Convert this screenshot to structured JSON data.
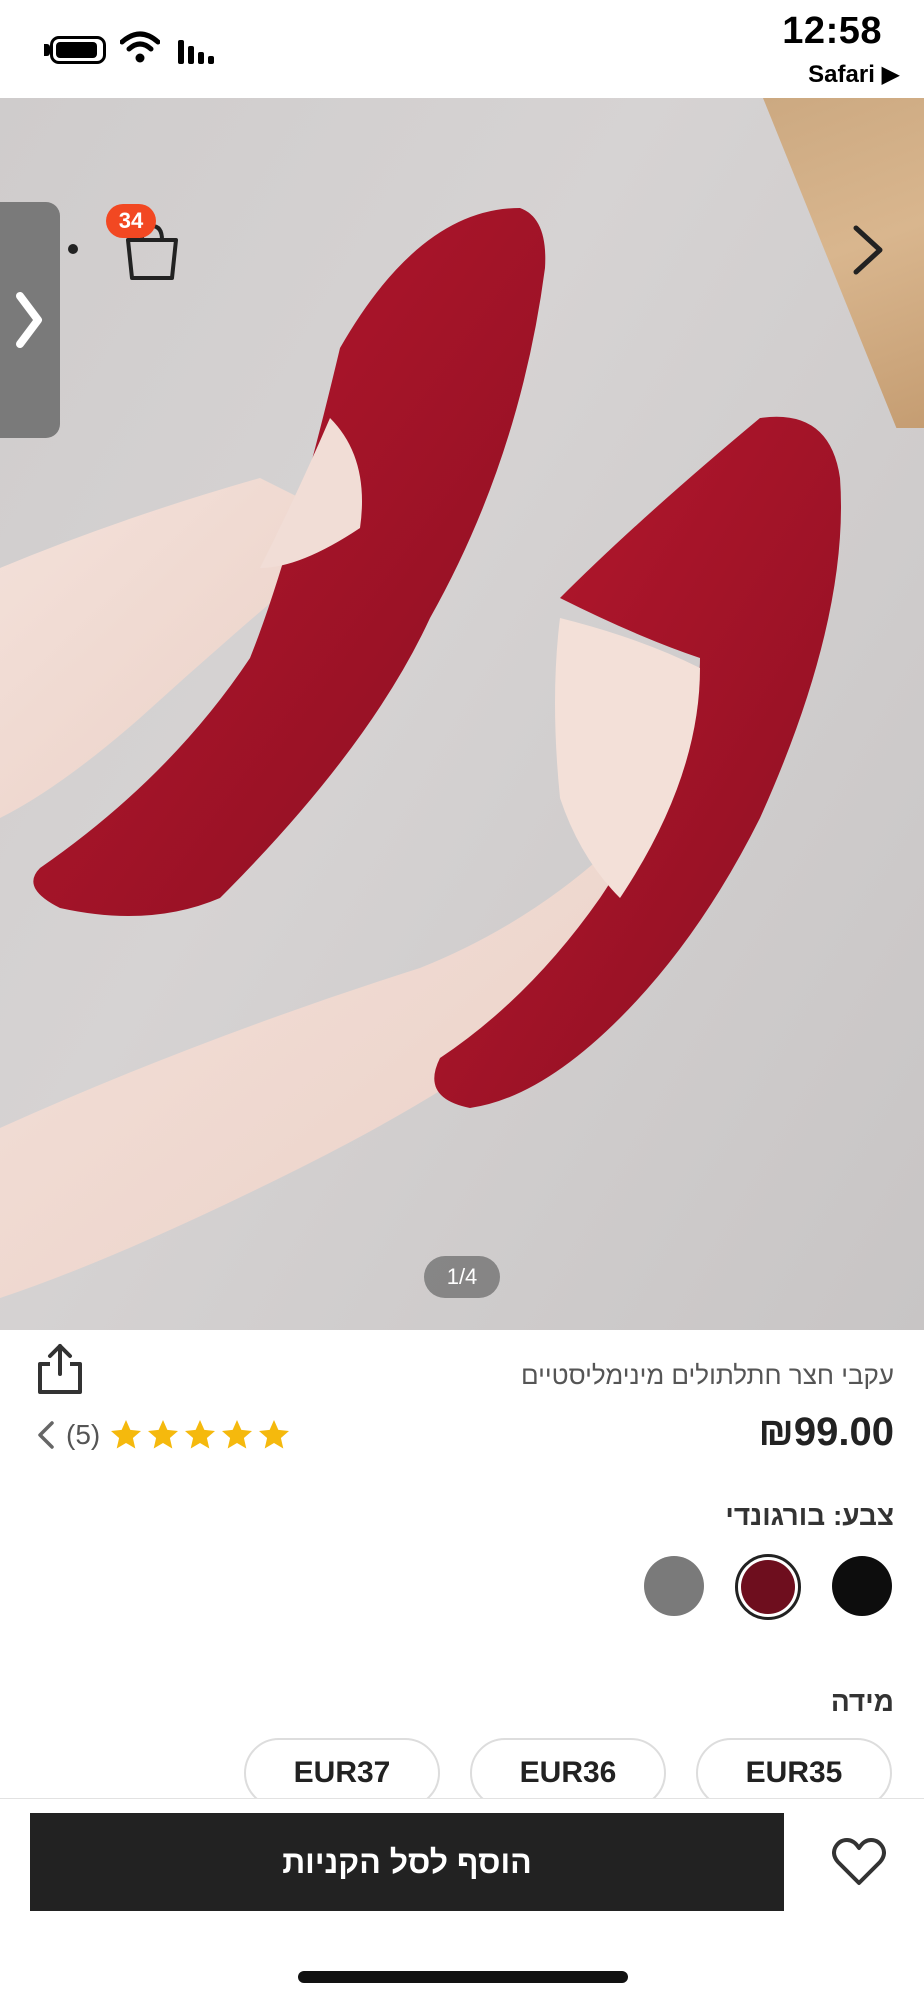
{
  "status_bar": {
    "time": "12:58",
    "back_app": "Safari ▶"
  },
  "gallery": {
    "pager": "1/4",
    "cart_count": "34"
  },
  "product": {
    "title": "עקבי חצר חתלתולים מינימליסטיים",
    "price": "₪99.00",
    "rating_stars": 5,
    "review_count": "(5)",
    "color_label": "צבע: בורגונדי",
    "colors": [
      {
        "name": "black",
        "hex": "#0d0d0d"
      },
      {
        "name": "burgundy",
        "hex": "#6e0e1e",
        "selected": true
      },
      {
        "name": "grey",
        "hex": "#7a7a7a"
      }
    ],
    "size_label": "מידה",
    "sizes": [
      "EUR35",
      "EUR36",
      "EUR37"
    ]
  },
  "actions": {
    "add_to_cart": "הוסף לסל הקניות"
  },
  "icons": {
    "cart": "shopping-bag-icon",
    "share": "share-icon",
    "wishlist": "heart-icon",
    "next": "chevron-right-icon",
    "side_tab": "chevron-right-icon"
  },
  "colors": {
    "badge": "#f24822",
    "star": "#f5b90d",
    "button": "#222222"
  }
}
